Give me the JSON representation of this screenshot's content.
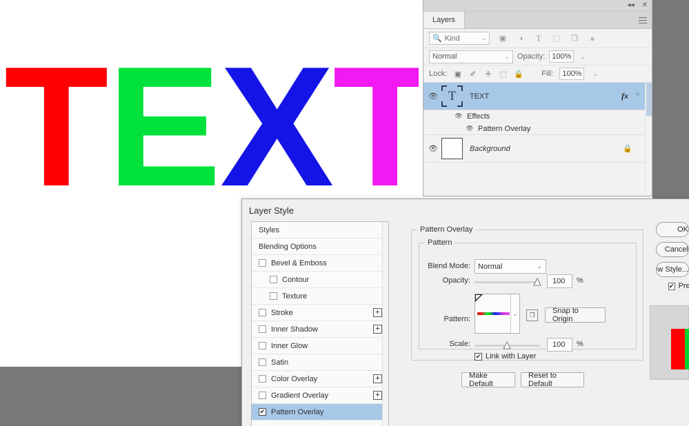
{
  "app": {
    "document_text": "TEXT",
    "letters": [
      {
        "char": "T",
        "color": "#ff0000"
      },
      {
        "char": "E",
        "color": "#00e13c"
      },
      {
        "char": "X",
        "color": "#1414e6"
      },
      {
        "char": "T",
        "color": "#f219f2"
      }
    ],
    "workspace_color": "#787878"
  },
  "layers_panel": {
    "tab_label": "Layers",
    "collapse_icon": "collapse-double-arrow-icon",
    "close_icon": "close-icon",
    "menu_icon": "panel-menu-icon",
    "filter": {
      "search_icon": "search-icon",
      "kind_label": "Kind",
      "chevron": "⌄",
      "icons": [
        {
          "name": "pixel-layer-filter-icon",
          "glyph": "▣"
        },
        {
          "name": "adjustment-layer-filter-icon",
          "glyph": "◑"
        },
        {
          "name": "type-layer-filter-icon",
          "glyph": "T"
        },
        {
          "name": "shape-layer-filter-icon",
          "glyph": "⬚"
        },
        {
          "name": "smart-object-filter-icon",
          "glyph": "❐"
        },
        {
          "name": "filter-toggle-icon",
          "glyph": "●"
        }
      ]
    },
    "blend": {
      "mode": "Normal",
      "opacity_label": "Opacity:",
      "opacity_value": "100%"
    },
    "lock": {
      "label": "Lock:",
      "icons": [
        {
          "name": "lock-transparency-icon",
          "glyph": "⌧"
        },
        {
          "name": "lock-image-pixels-icon",
          "glyph": "✐"
        },
        {
          "name": "lock-position-icon",
          "glyph": "✛"
        },
        {
          "name": "lock-artboard-nesting-icon",
          "glyph": "⬚"
        },
        {
          "name": "lock-all-icon",
          "glyph": "ὑ2"
        }
      ],
      "fill_label": "Fill:",
      "fill_value": "100%"
    },
    "layers": [
      {
        "name": "TEXT",
        "thumb": "T",
        "visible_icon": "eye-icon",
        "fx_label": "fx",
        "expand_icon": "chevron-up-icon",
        "selected": true,
        "effects": [
          {
            "label": "Effects",
            "icon": "eye-icon"
          },
          {
            "label": "Pattern Overlay",
            "icon": "eye-icon"
          }
        ]
      },
      {
        "name": "Background",
        "thumb": "white",
        "visible_icon": "eye-icon",
        "lock_icon": "lock-icon",
        "selected": false,
        "effects": []
      }
    ]
  },
  "layer_style_dialog": {
    "title": "Layer Style",
    "styles_list": [
      {
        "label": "Styles",
        "type": "plain"
      },
      {
        "label": "Blending Options",
        "type": "plain"
      },
      {
        "label": "Bevel & Emboss",
        "type": "checkbox",
        "checked": false,
        "plus": false
      },
      {
        "label": "Contour",
        "type": "checkbox",
        "checked": false,
        "indent": true,
        "plus": false
      },
      {
        "label": "Texture",
        "type": "checkbox",
        "checked": false,
        "indent": true,
        "plus": false
      },
      {
        "label": "Stroke",
        "type": "checkbox",
        "checked": false,
        "plus": true
      },
      {
        "label": "Inner Shadow",
        "type": "checkbox",
        "checked": false,
        "plus": true
      },
      {
        "label": "Inner Glow",
        "type": "checkbox",
        "checked": false,
        "plus": false
      },
      {
        "label": "Satin",
        "type": "checkbox",
        "checked": false,
        "plus": false
      },
      {
        "label": "Color Overlay",
        "type": "checkbox",
        "checked": false,
        "plus": true
      },
      {
        "label": "Gradient Overlay",
        "type": "checkbox",
        "checked": false,
        "plus": true
      },
      {
        "label": "Pattern Overlay",
        "type": "checkbox",
        "checked": true,
        "plus": false,
        "selected": true
      }
    ],
    "panel": {
      "section_title": "Pattern Overlay",
      "group_title": "Pattern",
      "blend_mode_label": "Blend Mode:",
      "blend_mode_value": "Normal",
      "opacity_label": "Opacity:",
      "opacity_value": "100",
      "opacity_unit": "%",
      "pattern_label": "Pattern:",
      "pattern_preset_icon": "new-preset-icon",
      "snap_button": "Snap to Origin",
      "scale_label": "Scale:",
      "scale_value": "100",
      "scale_unit": "%",
      "link_label": "Link with Layer",
      "link_checked": true,
      "make_default_button": "Make Default",
      "reset_button": "Reset to Default"
    },
    "right_buttons": [
      {
        "label": "OK"
      },
      {
        "label": "Cancel"
      },
      {
        "label": "New Style..."
      }
    ],
    "preview_label": "Preview",
    "preview_checked": true,
    "preview_thumb_bars": [
      "#ff0000",
      "#00d42c"
    ]
  }
}
